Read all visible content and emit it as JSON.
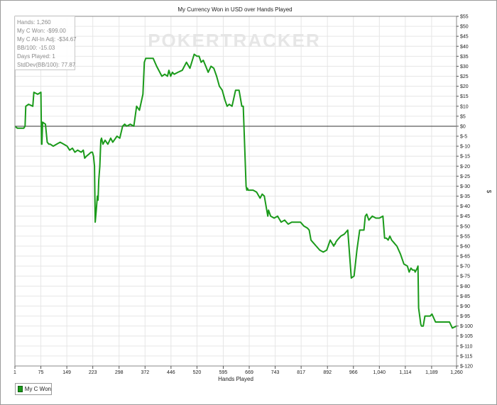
{
  "chart_data": {
    "type": "line",
    "title": "My Currency Won in USD over Hands Played",
    "xlabel": "Hands Played",
    "ylabel": "$",
    "ylim": [
      -120,
      55
    ],
    "xlim": [
      1,
      1260
    ],
    "xticks": [
      {
        "v": 1,
        "label": "1"
      },
      {
        "v": 75,
        "label": "75"
      },
      {
        "v": 149,
        "label": "149"
      },
      {
        "v": 223,
        "label": "223"
      },
      {
        "v": 298,
        "label": "298"
      },
      {
        "v": 372,
        "label": "372"
      },
      {
        "v": 446,
        "label": "446"
      },
      {
        "v": 520,
        "label": "520"
      },
      {
        "v": 595,
        "label": "595"
      },
      {
        "v": 669,
        "label": "669"
      },
      {
        "v": 743,
        "label": "743"
      },
      {
        "v": 817,
        "label": "817"
      },
      {
        "v": 892,
        "label": "892"
      },
      {
        "v": 966,
        "label": "966"
      },
      {
        "v": 1040,
        "label": "1,040"
      },
      {
        "v": 1114,
        "label": "1,114"
      },
      {
        "v": 1189,
        "label": "1,189"
      },
      {
        "v": 1260,
        "label": "1,260"
      }
    ],
    "yticks": [
      {
        "v": 55,
        "label": "$55"
      },
      {
        "v": 50,
        "label": "$50"
      },
      {
        "v": 45,
        "label": "$45"
      },
      {
        "v": 40,
        "label": "$40"
      },
      {
        "v": 35,
        "label": "$35"
      },
      {
        "v": 30,
        "label": "$30"
      },
      {
        "v": 25,
        "label": "$25"
      },
      {
        "v": 20,
        "label": "$20"
      },
      {
        "v": 15,
        "label": "$15"
      },
      {
        "v": 10,
        "label": "$10"
      },
      {
        "v": 5,
        "label": "$5"
      },
      {
        "v": 0,
        "label": "$0"
      },
      {
        "v": -5,
        "label": "$-5"
      },
      {
        "v": -10,
        "label": "$-10"
      },
      {
        "v": -15,
        "label": "$-15"
      },
      {
        "v": -20,
        "label": "$-20"
      },
      {
        "v": -25,
        "label": "$-25"
      },
      {
        "v": -30,
        "label": "$-30"
      },
      {
        "v": -35,
        "label": "$-35"
      },
      {
        "v": -40,
        "label": "$-40"
      },
      {
        "v": -45,
        "label": "$-45"
      },
      {
        "v": -50,
        "label": "$-50"
      },
      {
        "v": -55,
        "label": "$-55"
      },
      {
        "v": -60,
        "label": "$-60"
      },
      {
        "v": -65,
        "label": "$-65"
      },
      {
        "v": -70,
        "label": "$-70"
      },
      {
        "v": -75,
        "label": "$-75"
      },
      {
        "v": -80,
        "label": "$-80"
      },
      {
        "v": -85,
        "label": "$-85"
      },
      {
        "v": -90,
        "label": "$-90"
      },
      {
        "v": -95,
        "label": "$-95"
      },
      {
        "v": -100,
        "label": "$-100"
      },
      {
        "v": -105,
        "label": "$-105"
      },
      {
        "v": -110,
        "label": "$-110"
      },
      {
        "v": -115,
        "label": "$-115"
      },
      {
        "v": -120,
        "label": "$-120"
      }
    ],
    "grid": true,
    "legend_position": "bottom-left",
    "watermark": "POKERTRACKER",
    "series": [
      {
        "name": "My C Won",
        "color": "#1a9a1a",
        "x": [
          1,
          8,
          18,
          26,
          30,
          32,
          40,
          52,
          55,
          66,
          75,
          77,
          78,
          80,
          88,
          93,
          98,
          102,
          110,
          120,
          130,
          140,
          150,
          157,
          165,
          172,
          180,
          190,
          196,
          200,
          205,
          212,
          218,
          222,
          225,
          228,
          230,
          233,
          236,
          238,
          240,
          243,
          246,
          248,
          252,
          255,
          258,
          266,
          274,
          280,
          284,
          292,
          300,
          308,
          314,
          320,
          330,
          340,
          348,
          356,
          366,
          370,
          374,
          377,
          380,
          385,
          395,
          405,
          420,
          428,
          436,
          440,
          445,
          450,
          455,
          466,
          478,
          490,
          500,
          512,
          520,
          526,
          532,
          538,
          545,
          552,
          560,
          568,
          576,
          584,
          592,
          600,
          606,
          612,
          620,
          630,
          640,
          648,
          652,
          654,
          656,
          658,
          660,
          662,
          664,
          666,
          670,
          680,
          690,
          700,
          706,
          712,
          718,
          722,
          724,
          730,
          740,
          750,
          760,
          770,
          780,
          790,
          800,
          805,
          815,
          825,
          835,
          840,
          845,
          850,
          860,
          870,
          880,
          890,
          900,
          910,
          912,
          914,
          916,
          920,
          930,
          940,
          950,
          960,
          968,
          976,
          984,
          990,
          996,
          1000,
          1004,
          1006,
          1010,
          1020,
          1030,
          1040,
          1050,
          1055,
          1060,
          1065,
          1070,
          1075,
          1080,
          1085,
          1090,
          1100,
          1110,
          1120,
          1125,
          1130,
          1135,
          1140,
          1142,
          1145,
          1148,
          1150,
          1152,
          1158,
          1160,
          1165,
          1170,
          1180,
          1185,
          1190,
          1200,
          1210,
          1220,
          1230,
          1240,
          1248,
          1260
        ],
        "y": [
          0,
          -1,
          -1,
          -1,
          0,
          10,
          11,
          10,
          17,
          16,
          17,
          -9,
          -9,
          2,
          1,
          -8,
          -9,
          -9,
          -10,
          -9,
          -8,
          -9,
          -10,
          -12,
          -11,
          -13,
          -12,
          -13,
          -12,
          -16,
          -15,
          -14,
          -13,
          -13,
          -15,
          -20,
          -48,
          -42,
          -35,
          -37,
          -27,
          -20,
          -7,
          -6,
          -9,
          -8,
          -7,
          -9,
          -6,
          -8,
          -7,
          -5,
          -6,
          0,
          1,
          0,
          1,
          0,
          10,
          8,
          16,
          32,
          34,
          34,
          34,
          34,
          34,
          30,
          25,
          26,
          25,
          28,
          25,
          27,
          26,
          27,
          28,
          32,
          29,
          36,
          35,
          35,
          32,
          33,
          30,
          27,
          30,
          29,
          25,
          20,
          18,
          13,
          10,
          11,
          10,
          18,
          18,
          10,
          10,
          0,
          -10,
          -20,
          -30,
          -32,
          -31,
          -32,
          -32,
          -32,
          -33,
          -36,
          -34,
          -35,
          -41,
          -45,
          -42,
          -45,
          -46,
          -45,
          -48,
          -47,
          -49,
          -48,
          -48,
          -48,
          -48,
          -50,
          -51,
          -52,
          -57,
          -58,
          -60,
          -62,
          -63,
          -62,
          -57,
          -60,
          -59,
          -59,
          -58,
          -57,
          -55,
          -54,
          -52,
          -76,
          -75,
          -62,
          -52,
          -52,
          -52,
          -45,
          -44,
          -45,
          -47,
          -45,
          -46,
          -46,
          -45,
          -56,
          -56,
          -57,
          -55,
          -57,
          -58,
          -59,
          -60,
          -64,
          -69,
          -70,
          -73,
          -71,
          -72,
          -72,
          -73,
          -72,
          -71,
          -70,
          -91,
          -99,
          -100,
          -100,
          -95,
          -95,
          -95,
          -94,
          -98,
          -98,
          -98,
          -98,
          -98,
          -101,
          -100
        ]
      }
    ],
    "stats": [
      "Hands: 1,260",
      "My C Won: -$99.00",
      "My C All-In Adj: -$34.67",
      "BB/100: -15.03",
      "Days Played: 1",
      "StdDev(BB/100): 77.87"
    ]
  }
}
